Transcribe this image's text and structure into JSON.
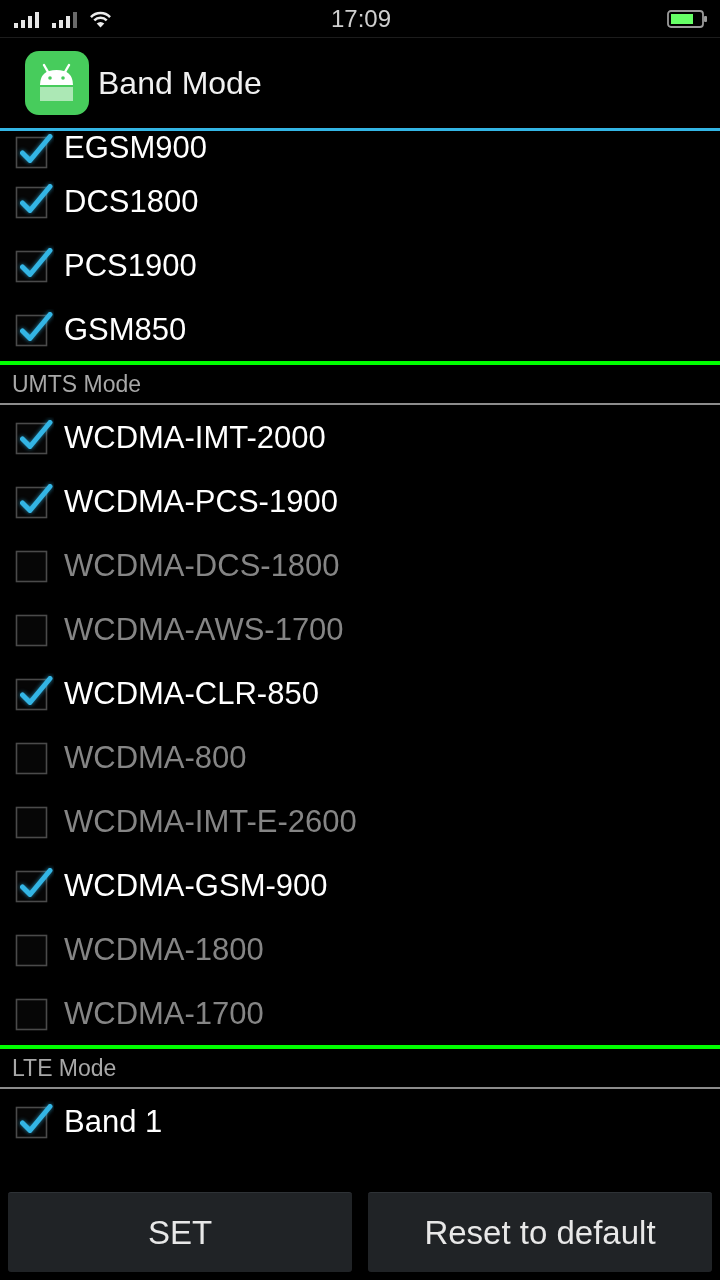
{
  "status_bar": {
    "time": "17:09"
  },
  "app_bar": {
    "title": "Band Mode"
  },
  "sections": [
    {
      "items": [
        {
          "label": "EGSM900",
          "checked": true
        },
        {
          "label": "DCS1800",
          "checked": true
        },
        {
          "label": "PCS1900",
          "checked": true
        },
        {
          "label": "GSM850",
          "checked": true
        }
      ]
    },
    {
      "title": "UMTS Mode",
      "items": [
        {
          "label": "WCDMA-IMT-2000",
          "checked": true
        },
        {
          "label": "WCDMA-PCS-1900",
          "checked": true
        },
        {
          "label": "WCDMA-DCS-1800",
          "checked": false
        },
        {
          "label": "WCDMA-AWS-1700",
          "checked": false
        },
        {
          "label": "WCDMA-CLR-850",
          "checked": true
        },
        {
          "label": "WCDMA-800",
          "checked": false
        },
        {
          "label": "WCDMA-IMT-E-2600",
          "checked": false
        },
        {
          "label": "WCDMA-GSM-900",
          "checked": true
        },
        {
          "label": "WCDMA-1800",
          "checked": false
        },
        {
          "label": "WCDMA-1700",
          "checked": false
        }
      ]
    },
    {
      "title": "LTE Mode",
      "items": [
        {
          "label": "Band 1",
          "checked": true
        }
      ]
    }
  ],
  "buttons": [
    {
      "label": "SET"
    },
    {
      "label": "Reset to default"
    }
  ]
}
